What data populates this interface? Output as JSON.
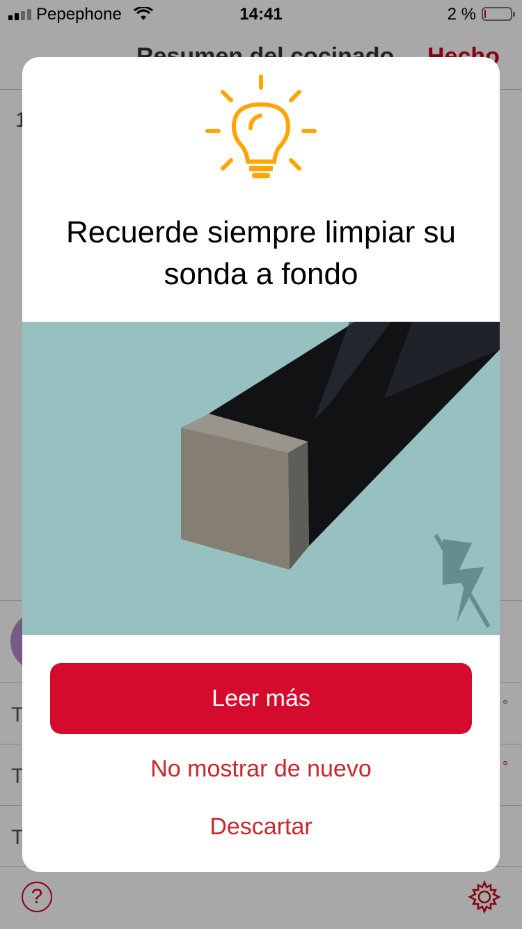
{
  "status_bar": {
    "carrier": "Pepephone",
    "time": "14:41",
    "battery_text": "2 %",
    "battery_level_fraction": 0.02
  },
  "background": {
    "nav_title": "Resumen del cocinado",
    "nav_done": "Hecho",
    "first_row_glyph": "1",
    "row_labels": [
      "T",
      "T",
      "T"
    ],
    "row_degree_symbol": "°",
    "help_glyph": "?",
    "accent_color": "#d0021b"
  },
  "modal": {
    "icon": "lightbulb-icon",
    "icon_color": "#ffa500",
    "title": "Recuerde siempre limpiar su sonda a fondo",
    "illustration": "probe-illustration",
    "illustration_bg_color": "#97c0c1",
    "primary_button": {
      "label": "Leer más",
      "color": "#d50b2d"
    },
    "secondary_link": "No mostrar de nuevo",
    "dismiss_link": "Descartar",
    "link_color": "#c8272d"
  }
}
